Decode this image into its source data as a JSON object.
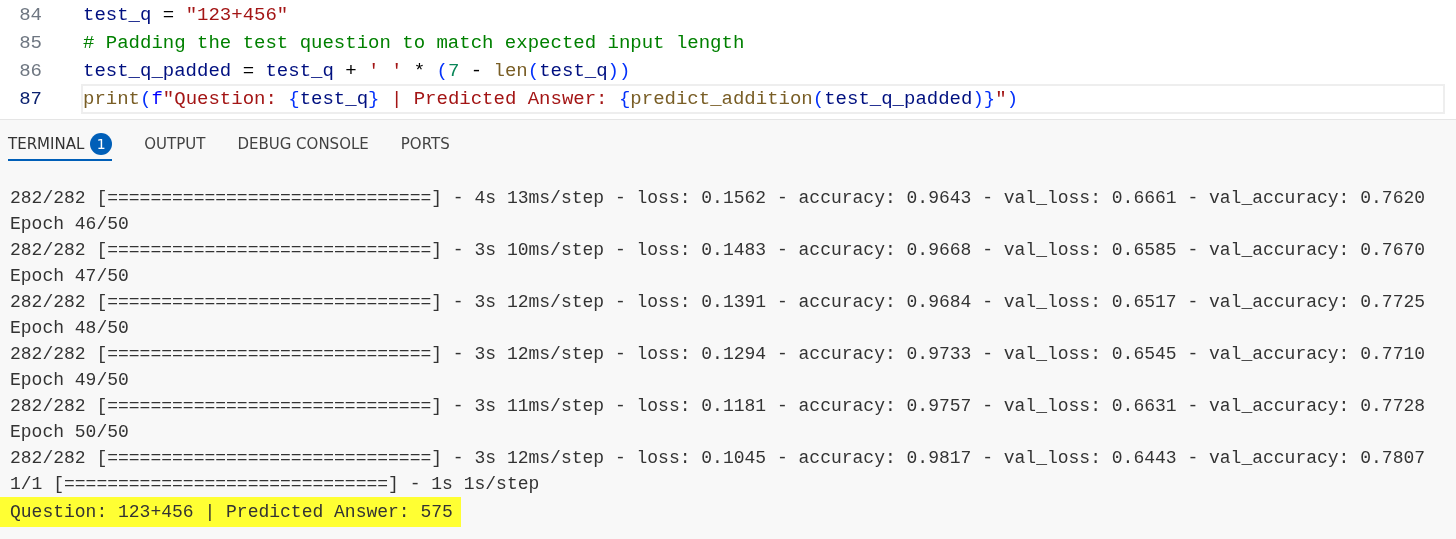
{
  "editor": {
    "lines": [
      {
        "number": "84",
        "current": false,
        "tokens": [
          {
            "kind": "var",
            "text": "test_q"
          },
          {
            "kind": "op",
            "text": " = "
          },
          {
            "kind": "str",
            "text": "\"123+456\""
          }
        ]
      },
      {
        "number": "85",
        "current": false,
        "tokens": [
          {
            "kind": "comment",
            "text": "# Padding the test question to match expected input length"
          }
        ]
      },
      {
        "number": "86",
        "current": false,
        "tokens": [
          {
            "kind": "var",
            "text": "test_q_padded"
          },
          {
            "kind": "op",
            "text": " = "
          },
          {
            "kind": "var",
            "text": "test_q"
          },
          {
            "kind": "op",
            "text": " + "
          },
          {
            "kind": "str",
            "text": "' '"
          },
          {
            "kind": "op",
            "text": " * "
          },
          {
            "kind": "paren",
            "text": "("
          },
          {
            "kind": "num",
            "text": "7"
          },
          {
            "kind": "op",
            "text": " - "
          },
          {
            "kind": "func",
            "text": "len"
          },
          {
            "kind": "paren",
            "text": "("
          },
          {
            "kind": "var",
            "text": "test_q"
          },
          {
            "kind": "paren",
            "text": "))"
          }
        ]
      },
      {
        "number": "87",
        "current": true,
        "tokens": [
          {
            "kind": "func",
            "text": "print"
          },
          {
            "kind": "paren",
            "text": "("
          },
          {
            "kind": "keyword",
            "text": "f"
          },
          {
            "kind": "str",
            "text": "\"Question: "
          },
          {
            "kind": "brace",
            "text": "{"
          },
          {
            "kind": "var",
            "text": "test_q"
          },
          {
            "kind": "brace",
            "text": "}"
          },
          {
            "kind": "str",
            "text": " | Predicted Answer: "
          },
          {
            "kind": "brace",
            "text": "{"
          },
          {
            "kind": "func",
            "text": "predict_addition"
          },
          {
            "kind": "paren",
            "text": "("
          },
          {
            "kind": "var",
            "text": "test_q_padded"
          },
          {
            "kind": "paren",
            "text": ")"
          },
          {
            "kind": "brace",
            "text": "}"
          },
          {
            "kind": "str",
            "text": "\""
          },
          {
            "kind": "paren",
            "text": ")"
          }
        ]
      }
    ]
  },
  "panel": {
    "tabs": [
      {
        "label": "TERMINAL",
        "selected": true,
        "badge": "1"
      },
      {
        "label": "OUTPUT",
        "selected": false
      },
      {
        "label": "DEBUG CONSOLE",
        "selected": false
      },
      {
        "label": "PORTS",
        "selected": false
      }
    ]
  },
  "terminal": {
    "lines": [
      {
        "text": "282/282 [==============================] - 4s 13ms/step - loss: 0.1562 - accuracy: 0.9643 - val_loss: 0.6661 - val_accuracy: 0.7620",
        "highlighted": false
      },
      {
        "text": "Epoch 46/50",
        "highlighted": false
      },
      {
        "text": "282/282 [==============================] - 3s 10ms/step - loss: 0.1483 - accuracy: 0.9668 - val_loss: 0.6585 - val_accuracy: 0.7670",
        "highlighted": false
      },
      {
        "text": "Epoch 47/50",
        "highlighted": false
      },
      {
        "text": "282/282 [==============================] - 3s 12ms/step - loss: 0.1391 - accuracy: 0.9684 - val_loss: 0.6517 - val_accuracy: 0.7725",
        "highlighted": false
      },
      {
        "text": "Epoch 48/50",
        "highlighted": false
      },
      {
        "text": "282/282 [==============================] - 3s 12ms/step - loss: 0.1294 - accuracy: 0.9733 - val_loss: 0.6545 - val_accuracy: 0.7710",
        "highlighted": false
      },
      {
        "text": "Epoch 49/50",
        "highlighted": false
      },
      {
        "text": "282/282 [==============================] - 3s 11ms/step - loss: 0.1181 - accuracy: 0.9757 - val_loss: 0.6631 - val_accuracy: 0.7728",
        "highlighted": false
      },
      {
        "text": "Epoch 50/50",
        "highlighted": false
      },
      {
        "text": "282/282 [==============================] - 3s 12ms/step - loss: 0.1045 - accuracy: 0.9817 - val_loss: 0.6443 - val_accuracy: 0.7807",
        "highlighted": false
      },
      {
        "text": "1/1 [==============================] - 1s 1s/step",
        "highlighted": false
      },
      {
        "text": "Question: 123+456 | Predicted Answer: 575",
        "highlighted": true
      }
    ]
  }
}
